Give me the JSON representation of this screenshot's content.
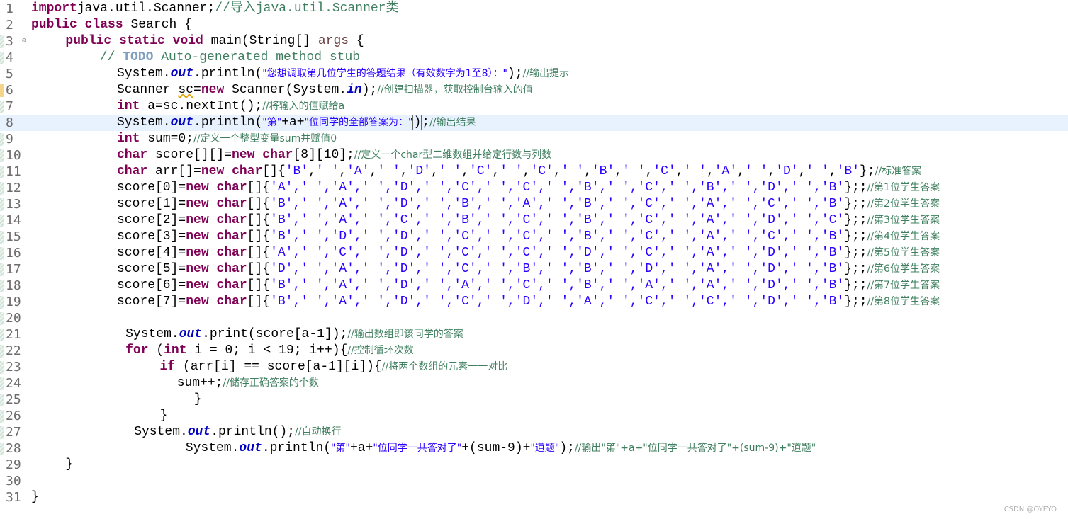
{
  "editor": {
    "gutter_fold_marker": "⊖",
    "current_line": 8,
    "watermark": "CSDN @OYFYO"
  },
  "lines": [
    {
      "n": "1",
      "indent": 0,
      "parts": [
        [
          "kw",
          "import"
        ],
        [
          "",
          "java.util.Scanner;"
        ],
        [
          "cm",
          "//导入java.util.Scanner类"
        ]
      ]
    },
    {
      "n": "2",
      "indent": 0,
      "parts": [
        [
          "kw",
          "public"
        ],
        [
          "",
          " "
        ],
        [
          "kw",
          "class"
        ],
        [
          "",
          " Search {"
        ]
      ]
    },
    {
      "n": "3",
      "indent": 2,
      "fold": true,
      "parts": [
        [
          "kw",
          "public"
        ],
        [
          "",
          " "
        ],
        [
          "kw",
          "static"
        ],
        [
          "",
          " "
        ],
        [
          "kw",
          "void"
        ],
        [
          "",
          " main(String[] "
        ],
        [
          "var",
          "args"
        ],
        [
          "",
          " {"
        ]
      ]
    },
    {
      "n": "4",
      "indent": 4,
      "parts": [
        [
          "cm",
          "// "
        ],
        [
          "todo",
          "TODO"
        ],
        [
          "cm",
          " Auto-generated method stub"
        ]
      ]
    },
    {
      "n": "5",
      "indent": 5,
      "parts": [
        [
          "",
          "System."
        ],
        [
          "fld",
          "out"
        ],
        [
          "",
          ".println("
        ],
        [
          "strcn",
          "\"您想调取第几位学生的答题结果（有效数字为1至8）：\""
        ],
        [
          "",
          ");"
        ],
        [
          "cmcn",
          "//输出提示"
        ]
      ]
    },
    {
      "n": "6",
      "indent": 5,
      "parts": [
        [
          "",
          "Scanner "
        ],
        [
          "uwarn",
          "sc"
        ],
        [
          "",
          "="
        ],
        [
          "kw",
          "new"
        ],
        [
          "",
          " Scanner(System."
        ],
        [
          "fld",
          "in"
        ],
        [
          "",
          ");"
        ],
        [
          "cmcn",
          "//创建扫描器，获取控制台输入的值"
        ]
      ]
    },
    {
      "n": "7",
      "indent": 5,
      "parts": [
        [
          "kw",
          "int"
        ],
        [
          "",
          " a=sc.nextInt();"
        ],
        [
          "cmcn",
          "//将输入的值赋给a"
        ]
      ]
    },
    {
      "n": "8",
      "indent": 5,
      "parts": [
        [
          "",
          "System."
        ],
        [
          "fld",
          "out"
        ],
        [
          "",
          ".println("
        ],
        [
          "strcn",
          "\"第\""
        ],
        [
          "",
          "+a+"
        ],
        [
          "strcn",
          "\"位同学的全部答案为：\""
        ],
        [
          "caret",
          ")"
        ],
        [
          "",
          ";"
        ],
        [
          "cmcn",
          "//输出结果"
        ]
      ]
    },
    {
      "n": "9",
      "indent": 5,
      "parts": [
        [
          "kw",
          "int"
        ],
        [
          "",
          " sum=0;"
        ],
        [
          "cmcn",
          "//定义一个整型变量sum并赋值0"
        ]
      ]
    },
    {
      "n": "10",
      "indent": 5,
      "parts": [
        [
          "kw",
          "char"
        ],
        [
          "",
          " score[][]="
        ],
        [
          "kw",
          "new"
        ],
        [
          "",
          " "
        ],
        [
          "kw",
          "char"
        ],
        [
          "",
          "[8][10];"
        ],
        [
          "cmcn",
          "//定义一个char型二维数组并给定行数与列数"
        ]
      ]
    },
    {
      "n": "11",
      "indent": 5,
      "parts": [
        [
          "kw",
          "char"
        ],
        [
          "",
          " arr[]="
        ],
        [
          "kw",
          "new"
        ],
        [
          "",
          " "
        ],
        [
          "kw",
          "char"
        ],
        [
          "",
          "[]{"
        ],
        [
          "str",
          "'B'"
        ],
        [
          ",",
          ","
        ],
        [
          "str",
          "' '"
        ],
        [
          ",",
          ","
        ],
        [
          "str",
          "'A'"
        ],
        [
          ",",
          ","
        ],
        [
          "str",
          "' '"
        ],
        [
          ",",
          ","
        ],
        [
          "str",
          "'D'"
        ],
        [
          ",",
          ","
        ],
        [
          "str",
          "' '"
        ],
        [
          ",",
          ","
        ],
        [
          "str",
          "'C'"
        ],
        [
          ",",
          ","
        ],
        [
          "str",
          "' '"
        ],
        [
          ",",
          ","
        ],
        [
          "str",
          "'C'"
        ],
        [
          ",",
          ","
        ],
        [
          "str",
          "' '"
        ],
        [
          ",",
          ","
        ],
        [
          "str",
          "'B'"
        ],
        [
          ",",
          ","
        ],
        [
          "str",
          "' '"
        ],
        [
          ",",
          ","
        ],
        [
          "str",
          "'C'"
        ],
        [
          ",",
          ","
        ],
        [
          "str",
          "' '"
        ],
        [
          ",",
          ","
        ],
        [
          "str",
          "'A'"
        ],
        [
          ",",
          ","
        ],
        [
          "str",
          "' '"
        ],
        [
          ",",
          ","
        ],
        [
          "str",
          "'D'"
        ],
        [
          ",",
          ","
        ],
        [
          "str",
          "' '"
        ],
        [
          ",",
          ","
        ],
        [
          "str",
          "'B'"
        ],
        [
          "",
          "};"
        ],
        [
          "cmcn",
          "//标准答案"
        ]
      ]
    },
    {
      "n": "12",
      "indent": 5,
      "parts": [
        [
          "",
          "score[0]="
        ],
        [
          "kw",
          "new"
        ],
        [
          "",
          " "
        ],
        [
          "kw",
          "char"
        ],
        [
          "",
          "[]{"
        ],
        [
          "str",
          "'A',' ','A',' ','D',' ','C',' ','C',' ','B',' ','C',' ','B',' ','D',' ','B'"
        ],
        [
          "",
          "};;"
        ],
        [
          "cmcn",
          "//第1位学生答案"
        ]
      ]
    },
    {
      "n": "13",
      "indent": 5,
      "parts": [
        [
          "",
          "score[1]="
        ],
        [
          "kw",
          "new"
        ],
        [
          "",
          " "
        ],
        [
          "kw",
          "char"
        ],
        [
          "",
          "[]{"
        ],
        [
          "str",
          "'B',' ','A',' ','D',' ','B',' ','A',' ','B',' ','C',' ','A',' ','C',' ','B'"
        ],
        [
          "",
          "};;"
        ],
        [
          "cmcn",
          "//第2位学生答案"
        ]
      ]
    },
    {
      "n": "14",
      "indent": 5,
      "parts": [
        [
          "",
          "score[2]="
        ],
        [
          "kw",
          "new"
        ],
        [
          "",
          " "
        ],
        [
          "kw",
          "char"
        ],
        [
          "",
          "[]{"
        ],
        [
          "str",
          "'B',' ','A',' ','C',' ','B',' ','C',' ','B',' ','C',' ','A',' ','D',' ','C'"
        ],
        [
          "",
          "};;"
        ],
        [
          "cmcn",
          "//第3位学生答案"
        ]
      ]
    },
    {
      "n": "15",
      "indent": 5,
      "parts": [
        [
          "",
          "score[3]="
        ],
        [
          "kw",
          "new"
        ],
        [
          "",
          " "
        ],
        [
          "kw",
          "char"
        ],
        [
          "",
          "[]{"
        ],
        [
          "str",
          "'B',' ','D',' ','D',' ','C',' ','C',' ','B',' ','C',' ','A',' ','C',' ','B'"
        ],
        [
          "",
          "};;"
        ],
        [
          "cmcn",
          "//第4位学生答案"
        ]
      ]
    },
    {
      "n": "16",
      "indent": 5,
      "parts": [
        [
          "",
          "score[4]="
        ],
        [
          "kw",
          "new"
        ],
        [
          "",
          " "
        ],
        [
          "kw",
          "char"
        ],
        [
          "",
          "[]{"
        ],
        [
          "str",
          "'A',' ','C',' ','D',' ','C',' ','C',' ','D',' ','C',' ','A',' ','D',' ','B'"
        ],
        [
          "",
          "};;"
        ],
        [
          "cmcn",
          "//第5位学生答案"
        ]
      ]
    },
    {
      "n": "17",
      "indent": 5,
      "parts": [
        [
          "",
          "score[5]="
        ],
        [
          "kw",
          "new"
        ],
        [
          "",
          " "
        ],
        [
          "kw",
          "char"
        ],
        [
          "",
          "[]{"
        ],
        [
          "str",
          "'D',' ','A',' ','D',' ','C',' ','B',' ','B',' ','D',' ','A',' ','D',' ','B'"
        ],
        [
          "",
          "};;"
        ],
        [
          "cmcn",
          "//第6位学生答案"
        ]
      ]
    },
    {
      "n": "18",
      "indent": 5,
      "parts": [
        [
          "",
          "score[6]="
        ],
        [
          "kw",
          "new"
        ],
        [
          "",
          " "
        ],
        [
          "kw",
          "char"
        ],
        [
          "",
          "[]{"
        ],
        [
          "str",
          "'B',' ','A',' ','D',' ','A',' ','C',' ','B',' ','A',' ','A',' ','D',' ','B'"
        ],
        [
          "",
          "};;"
        ],
        [
          "cmcn",
          "//第7位学生答案"
        ]
      ]
    },
    {
      "n": "19",
      "indent": 5,
      "parts": [
        [
          "",
          "score[7]="
        ],
        [
          "kw",
          "new"
        ],
        [
          "",
          " "
        ],
        [
          "kw",
          "char"
        ],
        [
          "",
          "[]{"
        ],
        [
          "str",
          "'B',' ','A',' ','D',' ','C',' ','D',' ','A',' ','C',' ','C',' ','D',' ','B'"
        ],
        [
          "",
          "};;"
        ],
        [
          "cmcn",
          "//第8位学生答案"
        ]
      ]
    },
    {
      "n": "20",
      "indent": 0,
      "parts": []
    },
    {
      "n": "21",
      "indent": 5.5,
      "parts": [
        [
          "",
          "System."
        ],
        [
          "fld",
          "out"
        ],
        [
          "",
          ".print(score[a-1]);"
        ],
        [
          "cmcn",
          "//输出数组即该同学的答案"
        ]
      ]
    },
    {
      "n": "22",
      "indent": 5.5,
      "parts": [
        [
          "kw",
          "for"
        ],
        [
          "",
          " ("
        ],
        [
          "kw",
          "int"
        ],
        [
          "",
          " i = 0; i < 19; i++){"
        ],
        [
          "cmcn",
          "//控制循环次数"
        ]
      ]
    },
    {
      "n": "23",
      "indent": 7.5,
      "parts": [
        [
          "kw",
          "if"
        ],
        [
          "",
          " (arr[i] == score[a-1][i]){"
        ],
        [
          "cmcn",
          "//将两个数组的元素一一对比"
        ]
      ]
    },
    {
      "n": "24",
      "indent": 8.5,
      "parts": [
        [
          "",
          "sum++;"
        ],
        [
          "cmcn",
          "//储存正确答案的个数"
        ]
      ]
    },
    {
      "n": "25",
      "indent": 9.5,
      "parts": [
        [
          "",
          "}"
        ]
      ]
    },
    {
      "n": "26",
      "indent": 7.5,
      "parts": [
        [
          "",
          "}"
        ]
      ]
    },
    {
      "n": "27",
      "indent": 6,
      "parts": [
        [
          "",
          "System."
        ],
        [
          "fld",
          "out"
        ],
        [
          "",
          ".println();"
        ],
        [
          "cmcn",
          "//自动换行"
        ]
      ]
    },
    {
      "n": "28",
      "indent": 9,
      "parts": [
        [
          "",
          "System."
        ],
        [
          "fld",
          "out"
        ],
        [
          "",
          ".println("
        ],
        [
          "strcn",
          "\"第\""
        ],
        [
          "",
          "+a+"
        ],
        [
          "strcn",
          "\"位同学一共答对了\""
        ],
        [
          "",
          "+(sum-9)+"
        ],
        [
          "strcn",
          "\"道题\""
        ],
        [
          "",
          ");"
        ],
        [
          "cmcn",
          "//输出\"第\"+a+\"位同学一共答对了\"+(sum-9)+\"道题\""
        ]
      ]
    },
    {
      "n": "29",
      "indent": 2,
      "parts": [
        [
          "",
          "}"
        ]
      ]
    },
    {
      "n": "30",
      "indent": 0,
      "parts": []
    },
    {
      "n": "31",
      "indent": 0,
      "parts": [
        [
          "",
          "}"
        ]
      ]
    }
  ]
}
